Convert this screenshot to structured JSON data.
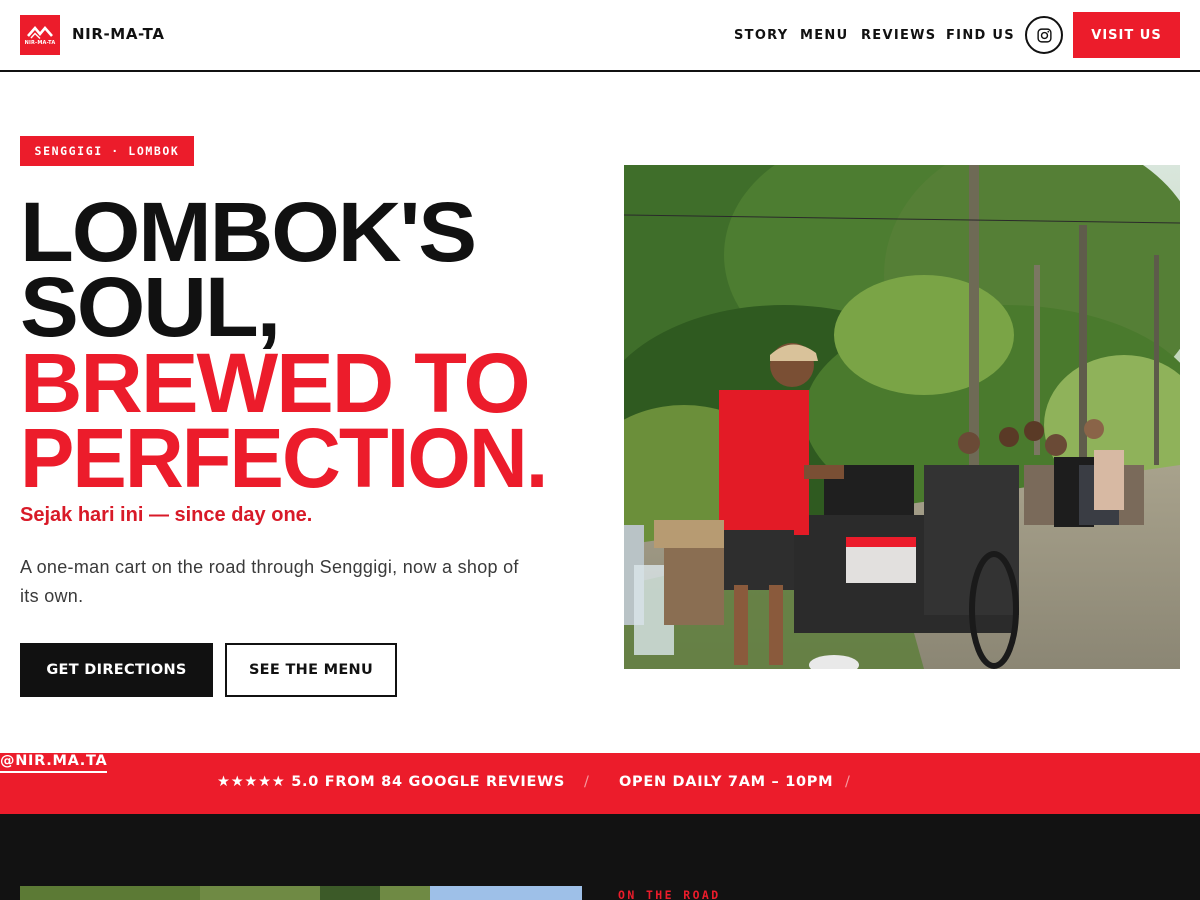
{
  "brand": {
    "logo_text": "NIR-MA-TA",
    "name": "NIR-MA-TA"
  },
  "nav": {
    "items": [
      "STORY",
      "MENU",
      "REVIEWS",
      "FIND US"
    ],
    "cta": "VISIT US",
    "instagram_icon": "instagram-icon"
  },
  "hero": {
    "badge": "SENGGIGI · LOMBOK",
    "headline_dark": [
      "LOMBOK'S",
      "SOUL,"
    ],
    "headline_red": [
      "BREWED TO",
      "PERFECTION."
    ],
    "tagline": "Sejak hari ini — since day one.",
    "description": "A one-man cart on the road through Senggigi, now a shop of its own.",
    "primary_button": "GET DIRECTIONS",
    "secondary_button": "SEE THE MENU"
  },
  "strip": {
    "rating": "★★★★★ 5.0 FROM 84 GOOGLE REVIEWS",
    "hours": "OPEN DAILY 7AM – 10PM",
    "handle": "@NIR.MA.TA",
    "separator": "/"
  },
  "section2": {
    "eyebrow": "ON THE ROAD"
  },
  "colors": {
    "accent": "#ec1c2b",
    "dark": "#111111",
    "section_bg": "#121212"
  }
}
